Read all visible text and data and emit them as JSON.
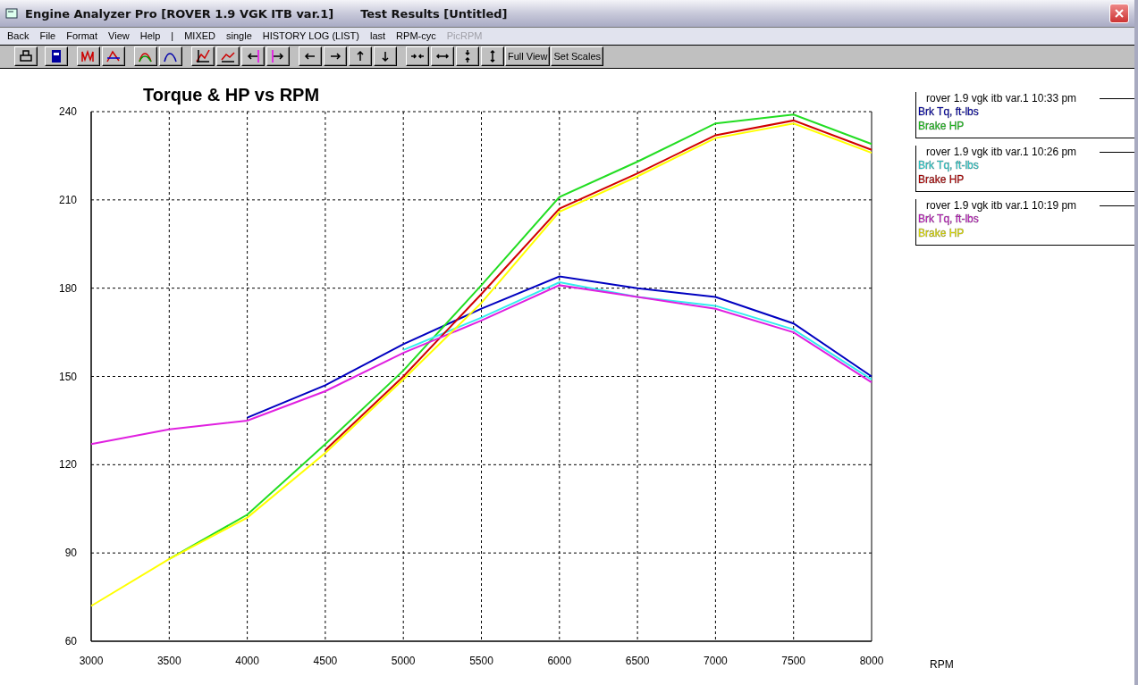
{
  "window": {
    "title": "Engine Analyzer Pro [ROVER 1.9 VGK ITB var.1]",
    "subtitle": "Test Results [Untitled]"
  },
  "menu": [
    {
      "label": "Back",
      "disabled": false
    },
    {
      "label": "File",
      "disabled": false
    },
    {
      "label": "Format",
      "disabled": false
    },
    {
      "label": "View",
      "disabled": false
    },
    {
      "label": "Help",
      "disabled": false
    },
    {
      "label": "|",
      "disabled": false
    },
    {
      "label": "MIXED",
      "disabled": false
    },
    {
      "label": "single",
      "disabled": false
    },
    {
      "label": "HISTORY LOG (LIST)",
      "disabled": false
    },
    {
      "label": "last",
      "disabled": false
    },
    {
      "label": "RPM-cyc",
      "disabled": false
    },
    {
      "label": "PicRPM",
      "disabled": true
    }
  ],
  "toolbar_text_buttons": [
    "Full View",
    "Set Scales"
  ],
  "legend_runs": [
    "rover 1.9 vgk itb var.1 10:33 pm",
    "rover 1.9 vgk itb var.1 10:26 pm",
    "rover 1.9 vgk itb var.1 10:19 pm"
  ],
  "chart_data": {
    "type": "line",
    "title": "Torque & HP vs RPM",
    "xlabel": "RPM",
    "grid": true,
    "x": [
      3000,
      3500,
      4000,
      4500,
      5000,
      5500,
      6000,
      6500,
      7000,
      7500,
      8000
    ],
    "xlim": [
      3000,
      8000
    ],
    "ylim": [
      60,
      240
    ],
    "xticks": [
      3000,
      3500,
      4000,
      4500,
      5000,
      5500,
      6000,
      6500,
      7000,
      7500,
      8000
    ],
    "yticks": [
      60,
      90,
      120,
      150,
      180,
      210,
      240
    ],
    "series": [
      {
        "name": "Brk Tq, ft-lbs",
        "color": "#0000c0",
        "values": [
          null,
          null,
          136,
          147,
          161,
          173,
          184,
          180,
          177,
          168,
          150
        ]
      },
      {
        "name": "Brake HP",
        "color": "#22dd22",
        "values": [
          null,
          88,
          103,
          127,
          152,
          181,
          211,
          223,
          236,
          239,
          229
        ]
      },
      {
        "name": "Brk Tq, ft-lbs",
        "color": "#33eeee",
        "values": [
          null,
          null,
          null,
          null,
          159,
          170,
          182,
          177,
          174,
          166,
          149
        ]
      },
      {
        "name": "Brake HP",
        "color": "#d00000",
        "values": [
          null,
          null,
          null,
          125,
          150,
          178,
          207,
          219,
          232,
          237,
          227
        ]
      },
      {
        "name": "Brk Tq, ft-lbs",
        "color": "#e020e0",
        "values": [
          127,
          132,
          135,
          145,
          158,
          169,
          181,
          177,
          173,
          165,
          148
        ]
      },
      {
        "name": "Brake HP",
        "color": "#ffff00",
        "values": [
          72,
          88,
          102,
          124,
          149,
          175,
          206,
          218,
          231,
          236,
          226
        ]
      }
    ]
  }
}
